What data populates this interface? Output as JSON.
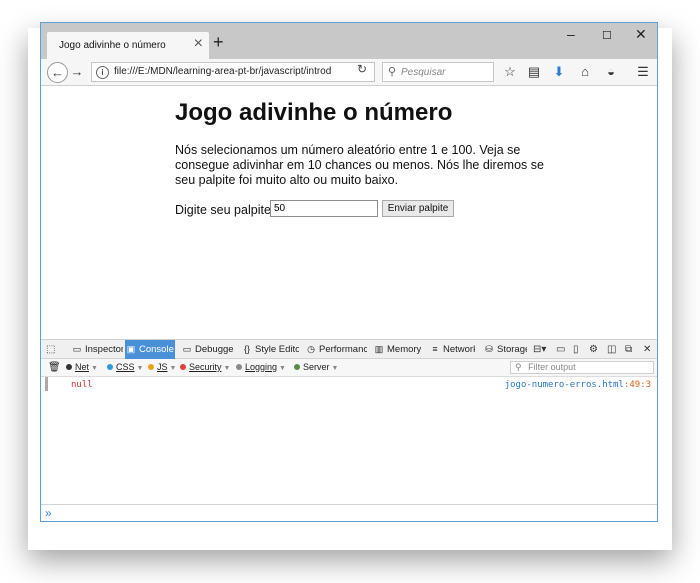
{
  "tab": {
    "title": "Jogo adivinhe o número"
  },
  "window": {
    "minimize": "–",
    "maximize": "☐",
    "close": "✕"
  },
  "nav": {
    "url": "file:///E:/MDN/learning-area-pt-br/javascript/introd",
    "search_placeholder": "Pesquisar"
  },
  "page": {
    "heading": "Jogo adivinhe o número",
    "intro": "Nós selecionamos um número aleatório entre 1 e 100. Veja se consegue adivinhar em 10 chances ou menos. Nós lhe diremos se seu palpite foi muito alto ou muito baixo.",
    "guess_label": "Digite seu palpite:",
    "guess_value": "50",
    "submit_label": "Enviar palpite"
  },
  "devtools": {
    "tabs": [
      {
        "label": "Inspector",
        "icon": "inspector-icon"
      },
      {
        "label": "Console",
        "icon": "console-icon"
      },
      {
        "label": "Debugger",
        "icon": "debugger-icon"
      },
      {
        "label": "Style Editor",
        "icon": "style-editor-icon"
      },
      {
        "label": "Performance",
        "icon": "performance-icon"
      },
      {
        "label": "Memory",
        "icon": "memory-icon"
      },
      {
        "label": "Network",
        "icon": "network-icon"
      },
      {
        "label": "Storage",
        "icon": "storage-icon"
      }
    ],
    "active_tab": "Console",
    "filters": [
      {
        "label": "Net",
        "color": "#333333"
      },
      {
        "label": "CSS",
        "color": "#2a9ce0"
      },
      {
        "label": "JS",
        "color": "#e8a21a"
      },
      {
        "label": "Security",
        "color": "#e0423a"
      },
      {
        "label": "Logging",
        "color": "#8a8a8a"
      },
      {
        "label": "Server",
        "color": "#5a8a4a"
      }
    ],
    "filter_placeholder": "Filter output",
    "log": {
      "message": "null",
      "source_file": "jogo-numero-erros.html",
      "source_line": ":49:3"
    },
    "prompt": "»"
  },
  "colors": {
    "accent": "#4a90d9",
    "window_border": "#5f9ed6"
  }
}
